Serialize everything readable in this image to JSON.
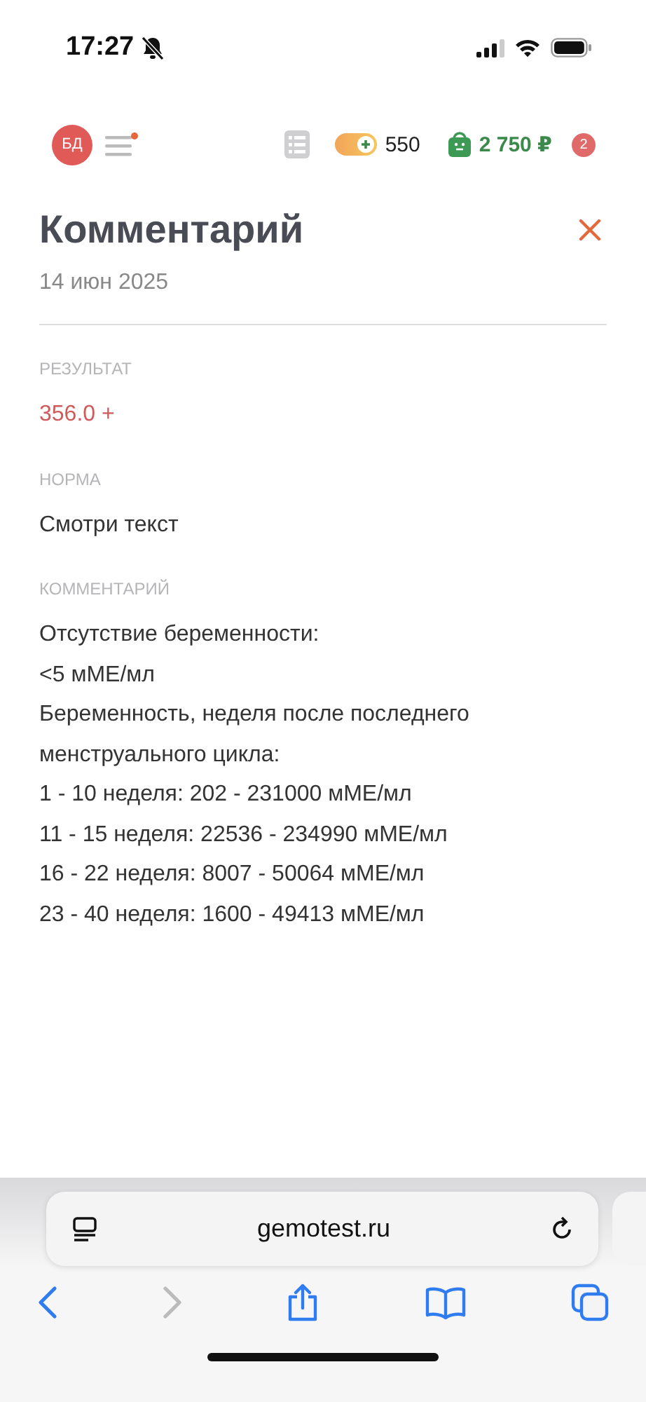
{
  "status_bar": {
    "time": "17:27"
  },
  "header": {
    "avatar": "БД",
    "menu_has_dot": true,
    "points": "550",
    "cart_total": "2 750 ₽",
    "cart_count": "2"
  },
  "modal": {
    "title": "Комментарий",
    "date": "14 июн 2025",
    "sections": [
      {
        "kind": "result",
        "label": "РЕЗУЛЬТАТ",
        "lines": [
          "356.0 +"
        ]
      },
      {
        "kind": "text",
        "label": "НОРМА",
        "lines": [
          "Смотри текст"
        ]
      },
      {
        "kind": "text",
        "label": "КОММЕНТАРИЙ",
        "lines": [
          "Отсутствие беременности:",
          "<5 мМЕ/мл",
          "Беременность, неделя после последнего менструального цикла:",
          "1 - 10 неделя: 202 - 231000 мМЕ/мл",
          "11 - 15 неделя: 22536 - 234990 мМЕ/мл",
          "16 - 22 неделя: 8007 - 50064 мМЕ/мл",
          "23 - 40 неделя: 1600 - 49413 мМЕ/мл"
        ]
      }
    ]
  },
  "browser": {
    "address": "gemotest.ru",
    "back_disabled": false,
    "forward_disabled": true
  }
}
